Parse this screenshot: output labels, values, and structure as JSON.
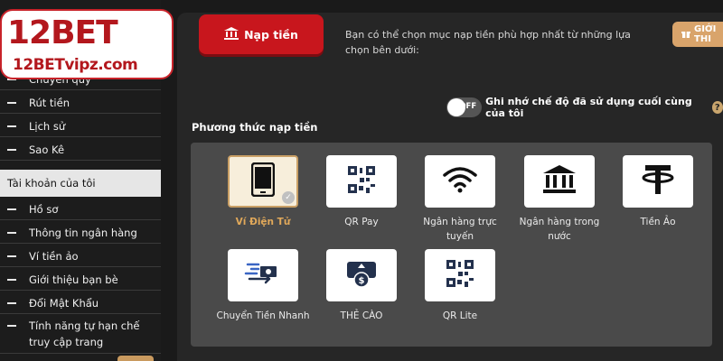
{
  "brand": {
    "logo_main_num": "12",
    "logo_main_text": "BET",
    "logo_sub": "12BETvipz.com"
  },
  "sidebar": {
    "top_items": [
      {
        "label": "Chuyển quỹ"
      },
      {
        "label": "Rút tiền"
      },
      {
        "label": "Lịch sử"
      },
      {
        "label": "Sao Kê"
      }
    ],
    "section_title": "Tài khoản của tôi",
    "account_items": [
      {
        "label": "Hồ sơ"
      },
      {
        "label": "Thông tin ngân hàng"
      },
      {
        "label": "Ví tiền ảo"
      },
      {
        "label": "Giới thiệu bạn bè"
      },
      {
        "label": "Đổi Mật Khẩu"
      },
      {
        "label": "Tính năng tự hạn chế truy cập trang"
      }
    ]
  },
  "header": {
    "deposit_tab": "Nạp tiền",
    "intro": "Bạn có thể chọn mục nạp tiền phù hợp nhất từ những lựa chọn bên dưới:",
    "intro_button": "GIỚI THI"
  },
  "toggle": {
    "state": "OFF",
    "label": "Ghi nhớ chế độ đã sử dụng cuối cùng của tôi",
    "help": "?"
  },
  "methods_title": "Phương thức nạp tiền",
  "methods": [
    {
      "label": "Ví Điện Tử",
      "icon": "phone-icon",
      "selected": true
    },
    {
      "label": "QR Pay",
      "icon": "qr-code-icon",
      "selected": false
    },
    {
      "label": "Ngân hàng trực tuyến",
      "icon": "wifi-icon",
      "selected": false
    },
    {
      "label": "Ngân hàng trong nước",
      "icon": "bank-icon",
      "selected": false
    },
    {
      "label": "Tiền Ảo",
      "icon": "tether-icon",
      "selected": false
    },
    {
      "label": "Chuyển Tiền Nhanh",
      "icon": "fast-transfer-icon",
      "selected": false
    },
    {
      "label": "THẺ CÀO",
      "icon": "scratch-card-icon",
      "selected": false
    },
    {
      "label": "QR Lite",
      "icon": "qr-code-icon",
      "selected": false
    }
  ],
  "colors": {
    "accent_red": "#c8161d",
    "gold": "#c9a56d",
    "selected_label": "#e0a85a"
  }
}
